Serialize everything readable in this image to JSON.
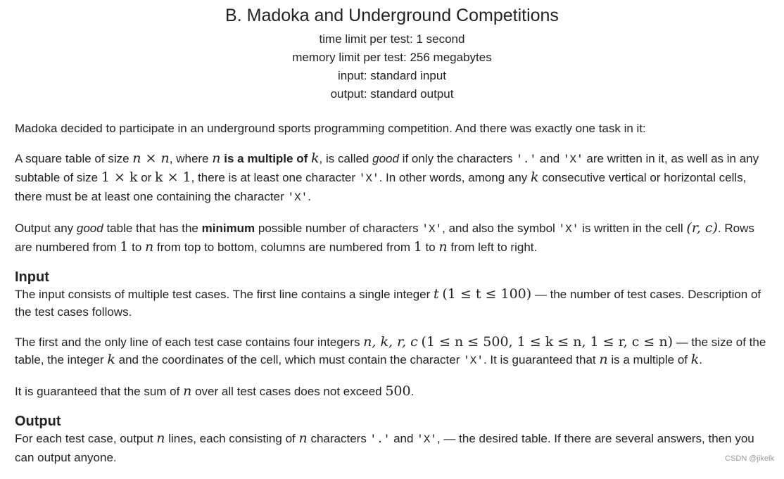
{
  "problem": {
    "title": "B. Madoka and Underground Competitions",
    "limits": [
      "time limit per test: 1 second",
      "memory limit per test: 256 megabytes",
      "input: standard input",
      "output: standard output"
    ]
  },
  "statement": {
    "p1": "Madoka decided to participate in an underground sports programming competition. And there was exactly one task in it:",
    "p2": {
      "t1": "A square table of size ",
      "m1": "n × n",
      "t2": ", where ",
      "m2": "n",
      "t3": " ",
      "b1": "is a multiple of",
      "t4": " ",
      "m3": "k",
      "t5": ", is called ",
      "i1": "good",
      "t6": " if only the characters ",
      "c1": "'.'",
      "t7": " and ",
      "c2": "'X'",
      "t8": " are written in it, as well as in any subtable of size ",
      "m4": "1 × k",
      "t9": " or ",
      "m5": "k × 1",
      "t10": ", there is at least one character ",
      "c3": "'X'",
      "t11": ". In other words, among any ",
      "m6": "k",
      "t12": " consecutive vertical or horizontal cells, there must be at least one containing the character ",
      "c4": "'X'",
      "t13": "."
    },
    "p3": {
      "t1": "Output any ",
      "i1": "good",
      "t2": " table that has the ",
      "b1": "minimum",
      "t3": " possible number of characters ",
      "c1": "'X'",
      "t4": ", and also the symbol ",
      "c2": "'X'",
      "t5": " is written in the cell ",
      "m1": "(r, c)",
      "t6": ". Rows are numbered from ",
      "m2": "1",
      "t7": " to ",
      "m3": "n",
      "t8": " from top to bottom, columns are numbered from ",
      "m4": "1",
      "t9": " to ",
      "m5": "n",
      "t10": " from left to right."
    }
  },
  "input_section": {
    "title": "Input",
    "p1": {
      "t1": "The input consists of multiple test cases. The first line contains a single integer ",
      "m1": "t",
      "t2": " ",
      "m2": "(1 ≤ t ≤ 100)",
      "t3": " — the number of test cases. Description of the test cases follows."
    },
    "p2": {
      "t1": "The first and the only line of each test case contains four integers ",
      "m1": "n, k, r, c",
      "t2": " ",
      "m2": "(1 ≤ n ≤ 500, 1 ≤ k ≤ n, 1 ≤ r, c ≤ n)",
      "t3": " — the size of the table, the integer ",
      "m3": "k",
      "t4": " and the coordinates of the cell, which must contain the character ",
      "c1": "'X'",
      "t5": ". It is guaranteed that ",
      "m4": "n",
      "t6": " is a multiple of ",
      "m5": "k",
      "t7": "."
    },
    "p3": {
      "t1": "It is guaranteed that the sum of ",
      "m1": "n",
      "t2": " over all test cases does not exceed ",
      "m2": "500",
      "t3": "."
    }
  },
  "output_section": {
    "title": "Output",
    "p1": {
      "t1": "For each test case, output ",
      "m1": "n",
      "t2": " lines, each consisting of ",
      "m2": "n",
      "t3": " characters ",
      "c1": "'.'",
      "t4": " and ",
      "c2": "'X'",
      "t5": ", — the desired table. If there are several answers, then you can output anyone."
    }
  },
  "watermark": "CSDN @jikelk"
}
